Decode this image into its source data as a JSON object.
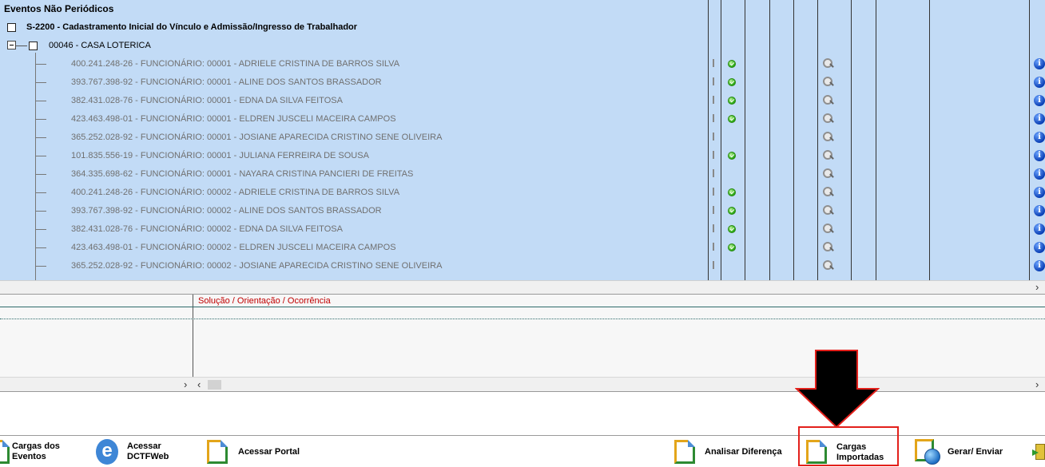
{
  "tree": {
    "section_title": "Eventos Não Periódicos",
    "event_title": "S-2200 - Cadastramento Inicial do Vínculo e Admissão/Ingresso de Trabalhador",
    "company_label": "00046 - CASA LOTERICA",
    "status_col_marker": "I",
    "rows": [
      {
        "text": "400.241.248-26 - FUNCIONÁRIO: 00001 - ADRIELE CRISTINA DE BARROS SILVA",
        "ok": true
      },
      {
        "text": "393.767.398-92 - FUNCIONÁRIO: 00001 - ALINE DOS SANTOS BRASSADOR",
        "ok": true
      },
      {
        "text": "382.431.028-76 - FUNCIONÁRIO: 00001 - EDNA DA SILVA FEITOSA",
        "ok": true
      },
      {
        "text": "423.463.498-01 - FUNCIONÁRIO: 00001 - ELDREN JUSCELI MACEIRA CAMPOS",
        "ok": true
      },
      {
        "text": "365.252.028-92 - FUNCIONÁRIO: 00001 - JOSIANE APARECIDA CRISTINO SENE OLIVEIRA",
        "ok": false
      },
      {
        "text": "101.835.556-19 - FUNCIONÁRIO: 00001 - JULIANA FERREIRA DE SOUSA",
        "ok": true
      },
      {
        "text": "364.335.698-62 - FUNCIONÁRIO: 00001 - NAYARA CRISTINA PANCIERI DE FREITAS",
        "ok": false
      },
      {
        "text": "400.241.248-26 - FUNCIONÁRIO: 00002 - ADRIELE CRISTINA DE BARROS SILVA",
        "ok": true
      },
      {
        "text": "393.767.398-92 - FUNCIONÁRIO: 00002 - ALINE DOS SANTOS BRASSADOR",
        "ok": true
      },
      {
        "text": "382.431.028-76 - FUNCIONÁRIO: 00002 - EDNA DA SILVA FEITOSA",
        "ok": true
      },
      {
        "text": "423.463.498-01 - FUNCIONÁRIO: 00002 - ELDREN JUSCELI MACEIRA CAMPOS",
        "ok": true
      },
      {
        "text": "365.252.028-92 - FUNCIONÁRIO: 00002 - JOSIANE APARECIDA CRISTINO SENE OLIVEIRA",
        "ok": false
      }
    ]
  },
  "messages": {
    "column_title": "Solução / Orientação / Ocorrência"
  },
  "scroll": {
    "left_arrow": "‹",
    "right_arrow": "›"
  },
  "toolbar": {
    "cargas_eventos": "Cargas dos\nEventos",
    "acessar_dctfweb": "Acessar\nDCTFWeb",
    "acessar_portal": "Acessar Portal",
    "analisar_diferenca": "Analisar Diferença",
    "cargas_importadas": "Cargas\nImportadas",
    "gerar_enviar": "Gerar/ Enviar",
    "e_icon_glyph": "e",
    "info_glyph": "i"
  },
  "colors": {
    "tree_bg": "#c2dbf6",
    "highlight": "#e3201b",
    "message_title": "#c00000"
  }
}
